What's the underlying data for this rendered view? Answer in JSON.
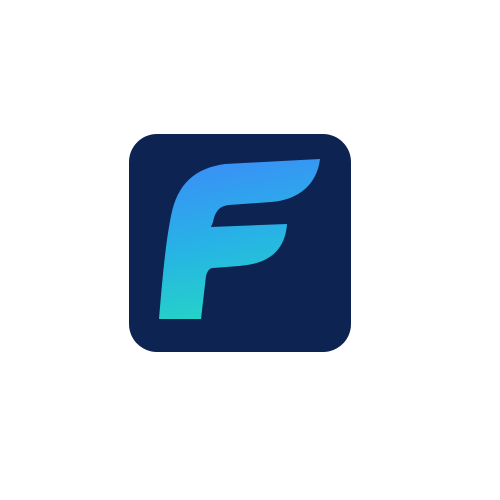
{
  "icon": {
    "name": "f-letter-logo-icon",
    "colors": {
      "tile_background": "#0d2453",
      "gradient_top": "#3a8ff7",
      "gradient_mid": "#27b3e6",
      "gradient_bottom": "#24d6c4"
    }
  }
}
